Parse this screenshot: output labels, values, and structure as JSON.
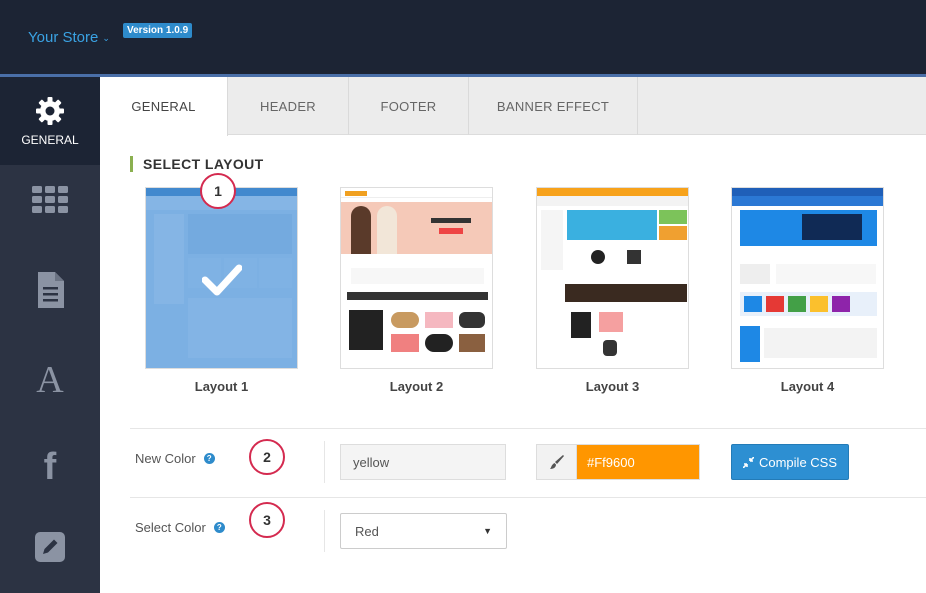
{
  "header": {
    "store_name": "Your Store",
    "version": "Version 1.0.9"
  },
  "sidebar": {
    "items": [
      {
        "label": "GENERAL",
        "icon": "gear-icon",
        "active": true
      },
      {
        "label": "",
        "icon": "grid-icon"
      },
      {
        "label": "",
        "icon": "document-icon"
      },
      {
        "label": "",
        "icon": "font-icon"
      },
      {
        "label": "",
        "icon": "facebook-icon"
      },
      {
        "label": "",
        "icon": "edit-icon"
      }
    ]
  },
  "tabs": [
    {
      "label": "GENERAL",
      "active": true
    },
    {
      "label": "HEADER"
    },
    {
      "label": "FOOTER"
    },
    {
      "label": "BANNER EFFECT"
    }
  ],
  "section": {
    "title": "SELECT LAYOUT"
  },
  "layouts": [
    {
      "name": "Layout 1",
      "selected": true
    },
    {
      "name": "Layout 2"
    },
    {
      "name": "Layout 3"
    },
    {
      "name": "Layout 4"
    }
  ],
  "badges": [
    "1",
    "2",
    "3"
  ],
  "new_color": {
    "label": "New Color",
    "value": "yellow",
    "hex": "#Ff9600"
  },
  "compile": {
    "label": "Compile CSS"
  },
  "select_color": {
    "label": "Select Color",
    "value": "Red"
  },
  "colors": {
    "accent": "#2d8fd2",
    "orange": "#ff9600",
    "badge_border": "#d42a4f",
    "sidebar": "#2c3343",
    "topbar": "#1c2434"
  }
}
